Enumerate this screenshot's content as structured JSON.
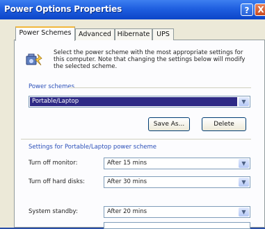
{
  "window": {
    "title": "Power Options Properties",
    "help_label": "?",
    "close_label": "X"
  },
  "tabs": [
    {
      "label": "Power Schemes",
      "active": true
    },
    {
      "label": "Advanced",
      "active": false
    },
    {
      "label": "Hibernate",
      "active": false
    },
    {
      "label": "UPS",
      "active": false
    }
  ],
  "description": "Select the power scheme with the most appropriate settings for this computer. Note that changing the settings below will modify the selected scheme.",
  "power_schemes": {
    "label": "Power schemes",
    "selected": "Portable/Laptop",
    "save_as_label": "Save As...",
    "delete_label": "Delete"
  },
  "settings": {
    "title": "Settings for Portable/Laptop power scheme",
    "rows": [
      {
        "label": "Turn off monitor:",
        "value": "After 15 mins"
      },
      {
        "label": "Turn off hard disks:",
        "value": "After 30 mins"
      },
      {
        "label": "System standby:",
        "value": "After 20 mins"
      },
      {
        "label": "",
        "value": ""
      }
    ]
  },
  "colors": {
    "titlebar": "#1f5fe0",
    "selection": "#2e2a86",
    "group_title": "#2a4fb8",
    "tab_highlight": "#f2b73a"
  },
  "icons": [
    "help-icon",
    "close-icon",
    "battery-power-icon",
    "chevron-down-icon"
  ]
}
